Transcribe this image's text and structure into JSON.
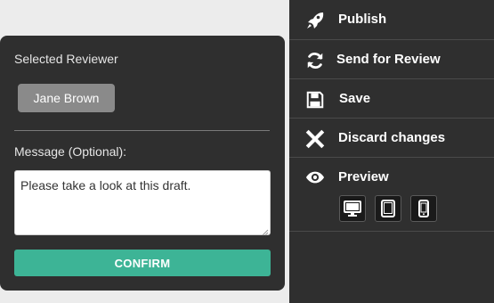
{
  "actions": {
    "publish_label": "Publish",
    "send_review_label": "Send for Review",
    "save_label": "Save",
    "discard_label": "Discard changes",
    "preview_label": "Preview"
  },
  "preview_devices": [
    {
      "name": "desktop",
      "icon": "desktop-icon"
    },
    {
      "name": "tablet",
      "icon": "tablet-icon"
    },
    {
      "name": "mobile",
      "icon": "mobile-icon"
    }
  ],
  "review_popover": {
    "heading": "Selected Reviewer",
    "reviewer": "Jane Brown",
    "message_label": "Message (Optional):",
    "message_value": "Please take a look at this draft.",
    "confirm_label": "CONFIRM"
  },
  "colors": {
    "panel_bg": "#2f2f2f",
    "page_bg": "#ececec",
    "confirm_green": "#3db496",
    "chip_gray": "#8a8a8a"
  }
}
